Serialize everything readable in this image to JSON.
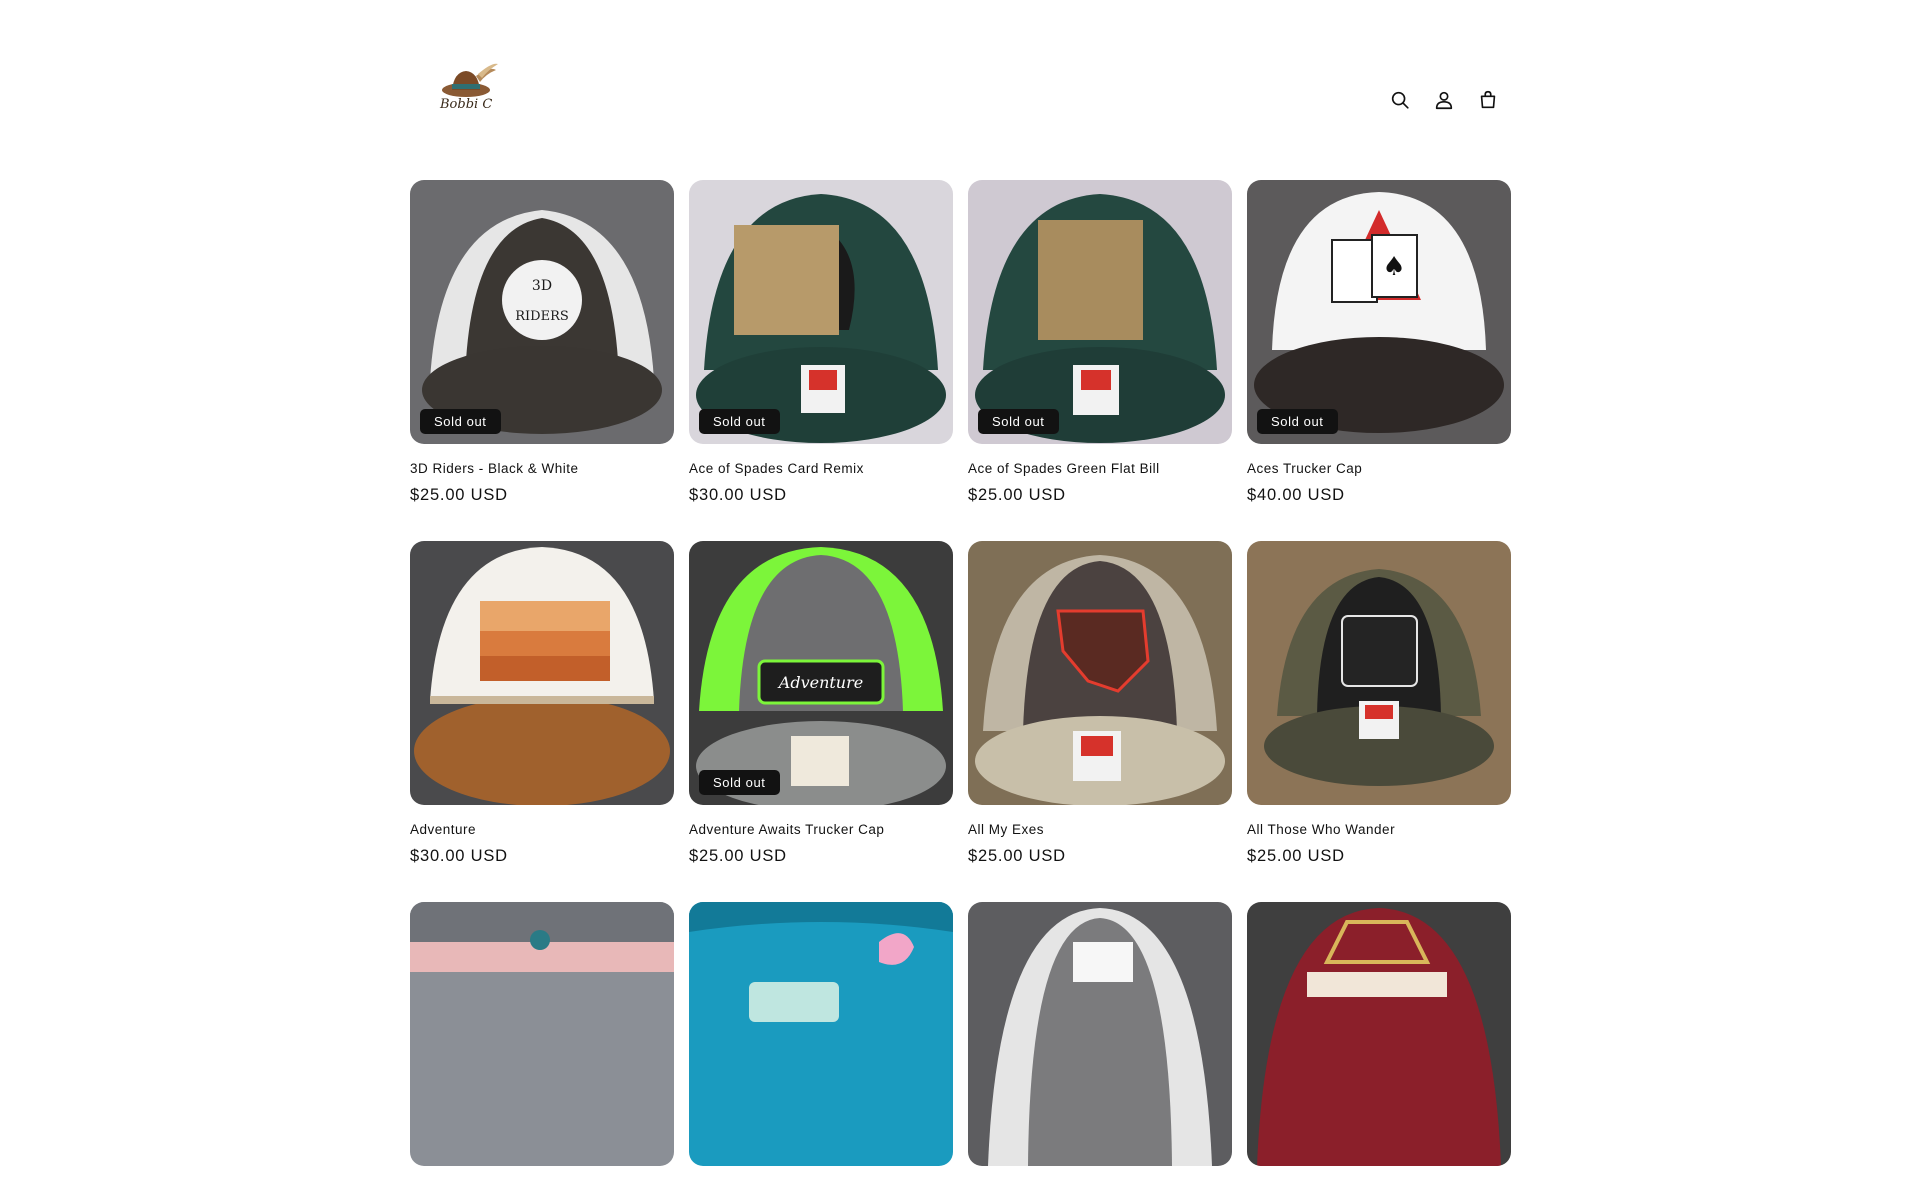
{
  "header": {
    "logo_alt": "Bobbi C",
    "icons": [
      "search-icon",
      "account-icon",
      "cart-icon"
    ]
  },
  "products": [
    {
      "title": "3D Riders - Black & White",
      "price": "$25.00 USD",
      "badge": "Sold out"
    },
    {
      "title": "Ace of Spades Card Remix",
      "price": "$30.00 USD",
      "badge": "Sold out"
    },
    {
      "title": "Ace of Spades Green Flat Bill",
      "price": "$25.00 USD",
      "badge": "Sold out"
    },
    {
      "title": "Aces Trucker Cap",
      "price": "$40.00 USD",
      "badge": "Sold out"
    },
    {
      "title": "Adventure",
      "price": "$30.00 USD",
      "badge": ""
    },
    {
      "title": "Adventure Awaits Trucker Cap",
      "price": "$25.00 USD",
      "badge": "Sold out"
    },
    {
      "title": "All My Exes",
      "price": "$25.00 USD",
      "badge": ""
    },
    {
      "title": "All Those Who Wander",
      "price": "$25.00 USD",
      "badge": ""
    },
    {
      "title": "",
      "price": "",
      "badge": ""
    },
    {
      "title": "",
      "price": "",
      "badge": ""
    },
    {
      "title": "",
      "price": "",
      "badge": ""
    },
    {
      "title": "",
      "price": "",
      "badge": ""
    }
  ],
  "colors": {
    "text": "#121212",
    "badge_bg": "#121212",
    "badge_text": "#ffffff",
    "background": "#ffffff"
  }
}
